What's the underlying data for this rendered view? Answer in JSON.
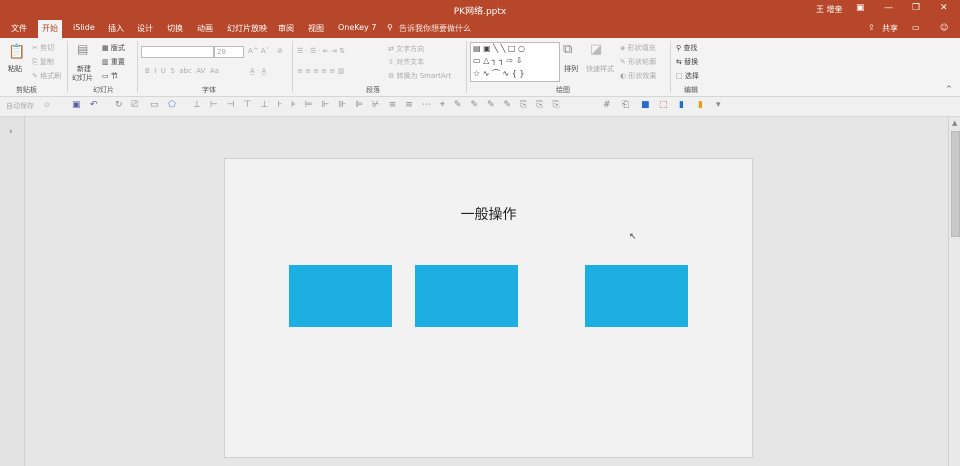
{
  "window": {
    "title": "PK网络.pptx",
    "user": "王 增奎"
  },
  "tabs": [
    {
      "label": "文件"
    },
    {
      "label": "开始"
    },
    {
      "label": "iSlide"
    },
    {
      "label": "插入"
    },
    {
      "label": "设计"
    },
    {
      "label": "切换"
    },
    {
      "label": "动画"
    },
    {
      "label": "幻灯片放映"
    },
    {
      "label": "审阅"
    },
    {
      "label": "视图"
    },
    {
      "label": "OneKey 7"
    }
  ],
  "tell_me": "告诉我你想要做什么",
  "share": "共享",
  "ribbon": {
    "clipboard": {
      "paste": "粘贴",
      "cut": "剪切",
      "copy": "复制",
      "format_painter": "格式刷",
      "label": "剪贴板"
    },
    "slides": {
      "new_slide": "新建",
      "new_slide2": "幻灯片",
      "layout": "版式",
      "reset": "重置",
      "section": "节",
      "label": "幻灯片"
    },
    "font": {
      "size": "28",
      "label": "字体"
    },
    "paragraph": {
      "text_direction": "文字方向",
      "align_text": "对齐文本",
      "smartart": "转换为 SmartArt",
      "label": "段落"
    },
    "drawing": {
      "arrange": "排列",
      "quick_styles": "快速样式",
      "shape_fill": "形状填充",
      "shape_outline": "形状轮廓",
      "shape_effects": "形状效果",
      "label": "绘图"
    },
    "editing": {
      "find": "查找",
      "replace": "替换",
      "select": "选择",
      "label": "编辑"
    }
  },
  "qat": {
    "autosave": "自动保存"
  },
  "slide": {
    "title": "一般操作"
  },
  "colors": {
    "accent": "#b7472a",
    "shape_fill": "#1daee2"
  }
}
